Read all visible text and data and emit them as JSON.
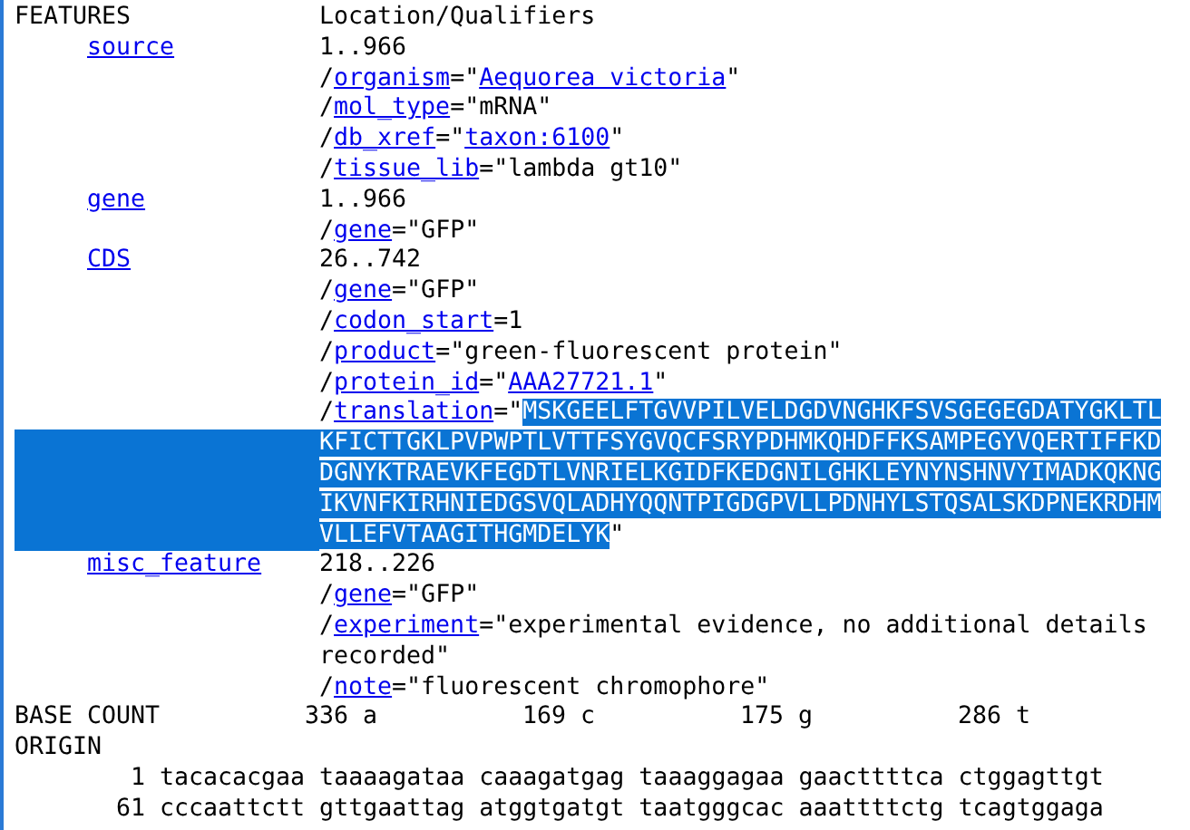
{
  "header": {
    "key": "FEATURES",
    "content": "Location/Qualifiers"
  },
  "features": [
    {
      "key": "source",
      "lines": [
        {
          "segments": [
            {
              "text": "1..966"
            }
          ]
        },
        {
          "segments": [
            {
              "text": "/"
            },
            {
              "text": "organism",
              "link": true
            },
            {
              "text": "=\""
            },
            {
              "text": "Aequorea victoria",
              "link": true
            },
            {
              "text": "\""
            }
          ]
        },
        {
          "segments": [
            {
              "text": "/"
            },
            {
              "text": "mol_type",
              "link": true
            },
            {
              "text": "=\"mRNA\""
            }
          ]
        },
        {
          "segments": [
            {
              "text": "/"
            },
            {
              "text": "db_xref",
              "link": true
            },
            {
              "text": "=\""
            },
            {
              "text": "taxon:6100",
              "link": true
            },
            {
              "text": "\""
            }
          ]
        },
        {
          "segments": [
            {
              "text": "/"
            },
            {
              "text": "tissue_lib",
              "link": true
            },
            {
              "text": "=\"lambda gt10\""
            }
          ]
        }
      ]
    },
    {
      "key": "gene",
      "lines": [
        {
          "segments": [
            {
              "text": "1..966"
            }
          ]
        },
        {
          "segments": [
            {
              "text": "/"
            },
            {
              "text": "gene",
              "link": true
            },
            {
              "text": "=\"GFP\""
            }
          ]
        }
      ]
    },
    {
      "key": "CDS",
      "lines": [
        {
          "segments": [
            {
              "text": "26..742"
            }
          ]
        },
        {
          "segments": [
            {
              "text": "/"
            },
            {
              "text": "gene",
              "link": true
            },
            {
              "text": "=\"GFP\""
            }
          ]
        },
        {
          "segments": [
            {
              "text": "/"
            },
            {
              "text": "codon_start",
              "link": true
            },
            {
              "text": "=1"
            }
          ]
        },
        {
          "segments": [
            {
              "text": "/"
            },
            {
              "text": "product",
              "link": true
            },
            {
              "text": "=\"green-fluorescent protein\""
            }
          ]
        },
        {
          "segments": [
            {
              "text": "/"
            },
            {
              "text": "protein_id",
              "link": true
            },
            {
              "text": "=\""
            },
            {
              "text": "AAA27721.1",
              "link": true
            },
            {
              "text": "\""
            }
          ]
        },
        {
          "selected": false,
          "segments": [
            {
              "text": "/"
            },
            {
              "text": "translation",
              "link": true
            },
            {
              "text": "=\""
            },
            {
              "text": "MSKGEELFTGVVPILVELDGDVNGHKFSVSGEGEGDATYGKLTL",
              "selected": true
            }
          ]
        },
        {
          "selected": true,
          "segments": [
            {
              "text": "KFICTTGKLPVPWPTLVTTFSYGVQCFSRYPDHMKQHDFFKSAMPEGYVQERTIFFKD",
              "selected": true
            }
          ]
        },
        {
          "selected": true,
          "segments": [
            {
              "text": "DGNYKTRAEVKFEGDTLVNRIELKGIDFKEDGNILGHKLEYNYNSHNVYIMADKQKNG",
              "selected": true
            }
          ]
        },
        {
          "selected": true,
          "segments": [
            {
              "text": "IKVNFKIRHNIEDGSVQLADHYQQNTPIGDGPVLLPDNHYLSTQSALSKDPNEKRDHM",
              "selected": true
            }
          ]
        },
        {
          "selected": true,
          "segments": [
            {
              "text": "VLLEFVTAAGITHGMDELYK",
              "selected": true
            },
            {
              "text": "\""
            }
          ]
        }
      ]
    },
    {
      "key": "misc_feature",
      "lines": [
        {
          "segments": [
            {
              "text": "218..226"
            }
          ]
        },
        {
          "segments": [
            {
              "text": "/"
            },
            {
              "text": "gene",
              "link": true
            },
            {
              "text": "=\"GFP\""
            }
          ]
        },
        {
          "segments": [
            {
              "text": "/"
            },
            {
              "text": "experiment",
              "link": true
            },
            {
              "text": "=\"experimental evidence, no additional details"
            }
          ]
        },
        {
          "segments": [
            {
              "text": "recorded\""
            }
          ]
        },
        {
          "segments": [
            {
              "text": "/"
            },
            {
              "text": "note",
              "link": true
            },
            {
              "text": "=\"fluorescent chromophore\""
            }
          ]
        }
      ]
    }
  ],
  "base_count": {
    "label": "BASE COUNT",
    "counts": [
      "336 a",
      "169 c",
      "175 g",
      "286 t"
    ]
  },
  "origin": {
    "label": "ORIGIN",
    "rows": [
      {
        "number": "1",
        "sequence": "tacacacgaa taaaagataa caaagatgag taaaggagaa gaacttttca ctggagttgt"
      },
      {
        "number": "61",
        "sequence": "cccaattctt gttgaattag atggtgatgt taatgggcac aaattttctg tcagtggaga"
      }
    ]
  }
}
